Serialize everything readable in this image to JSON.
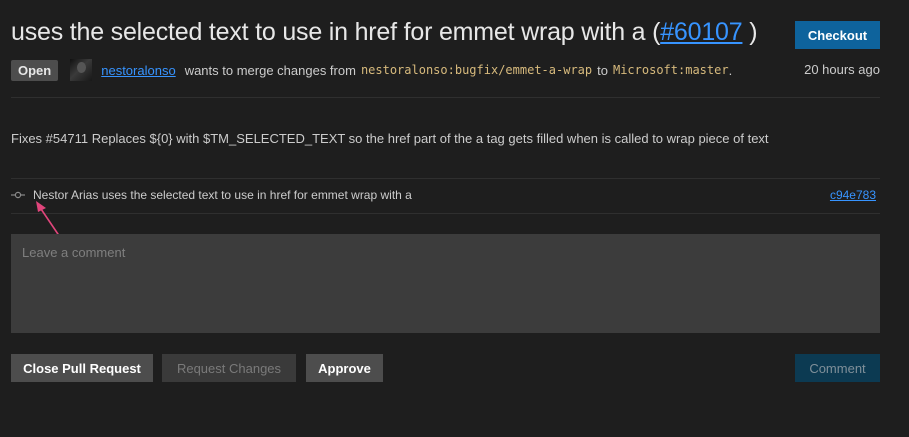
{
  "header": {
    "title": "uses the selected text to use in href for emmet wrap with a",
    "title_open_paren": " (",
    "pr_number": "#60107",
    "title_close_paren": " )",
    "checkout_label": "Checkout"
  },
  "meta": {
    "status": "Open",
    "author": "nestoralonso",
    "merge_text": "wants to merge changes from",
    "source_branch": "nestoralonso:bugfix/emmet-a-wrap",
    "to_text": "to",
    "target_branch": "Microsoft:master",
    "period": ".",
    "timestamp": "20 hours ago"
  },
  "description": "Fixes #54711 Replaces ${0} with $TM_SELECTED_TEXT so the href part of the a tag gets filled when is called to wrap piece of text",
  "commit": {
    "icon": "git-commit-icon",
    "message": "Nestor Arias uses the selected text to use in href for emmet wrap with a",
    "sha": "c94e783"
  },
  "comment": {
    "placeholder": "Leave a comment",
    "value": ""
  },
  "actions": {
    "close_label": "Close Pull Request",
    "request_changes_label": "Request Changes",
    "approve_label": "Approve",
    "comment_label": "Comment"
  },
  "colors": {
    "background": "#1e1e1e",
    "link": "#3794ff",
    "primary_button": "#0e639c",
    "branch": "#d7ba7d",
    "annotation_arrow": "#e0457b"
  }
}
